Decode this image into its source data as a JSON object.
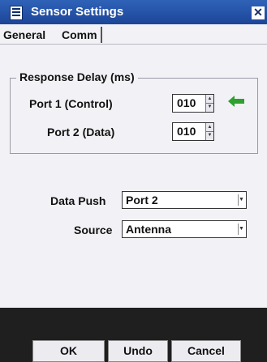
{
  "window": {
    "title": "Sensor Settings",
    "close_glyph": "✕",
    "app_icon": "window-icon"
  },
  "tabs": [
    {
      "label": "General",
      "active": false
    },
    {
      "label": "Comm",
      "active": true
    }
  ],
  "response_delay": {
    "legend": "Response Delay (ms)",
    "port1": {
      "label": "Port 1 (Control)",
      "value": "010"
    },
    "port2": {
      "label": "Port 2 (Data)",
      "value": "010"
    },
    "indicator": {
      "icon": "left-arrow-icon",
      "color": "#2ea02e"
    }
  },
  "data_push": {
    "label": "Data Push",
    "value": "Port 2"
  },
  "source": {
    "label": "Source",
    "value": "Antenna"
  },
  "buttons": {
    "ok": "OK",
    "undo": "Undo",
    "cancel": "Cancel"
  },
  "colors": {
    "titlebar": "#2557ad",
    "bottombar": "#1f1f1f"
  }
}
